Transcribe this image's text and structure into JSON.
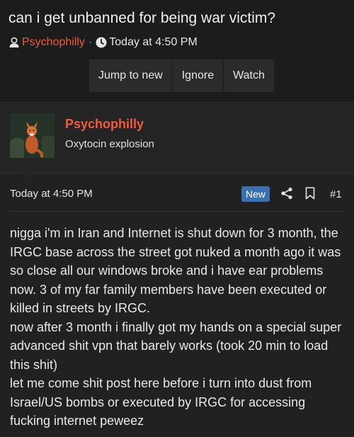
{
  "thread": {
    "title": "can i get unbanned for being war victim?",
    "author": "Psychophilly",
    "separator": "·",
    "date": "Today at 4:50 PM"
  },
  "actions": {
    "jump_to_new": "Jump to new",
    "ignore": "Ignore",
    "watch": "Watch"
  },
  "post": {
    "username": "Psychophilly",
    "user_title": "Oxytocin explosion",
    "date": "Today at 4:50 PM",
    "badge": "New",
    "number": "#1",
    "message": "nigga i'm in Iran and Internet is shut down for 3 month, the IRGC base across the street got nuked a month ago it was so close all our windows broke and i have ear problems now. 3 of my far family members have been executed or killed in streets by IRGC.\nnow after 3 month i finally got my hands on a special super advanced shit vpn that barely works (took 20 min to load this shit)\nlet me come shit post here before i turn into dust from Israel/US bombs or executed by IRGC for accessing fucking internet peweez"
  },
  "icons": {
    "author": "user-icon",
    "date": "clock-icon",
    "share": "share-icon",
    "bookmark": "bookmark-icon"
  },
  "colors": {
    "background": "#1c1c1c",
    "accent_username": "#ef5a43",
    "badge_new": "#3a6fb0",
    "button_bg": "#2b2b2b"
  }
}
